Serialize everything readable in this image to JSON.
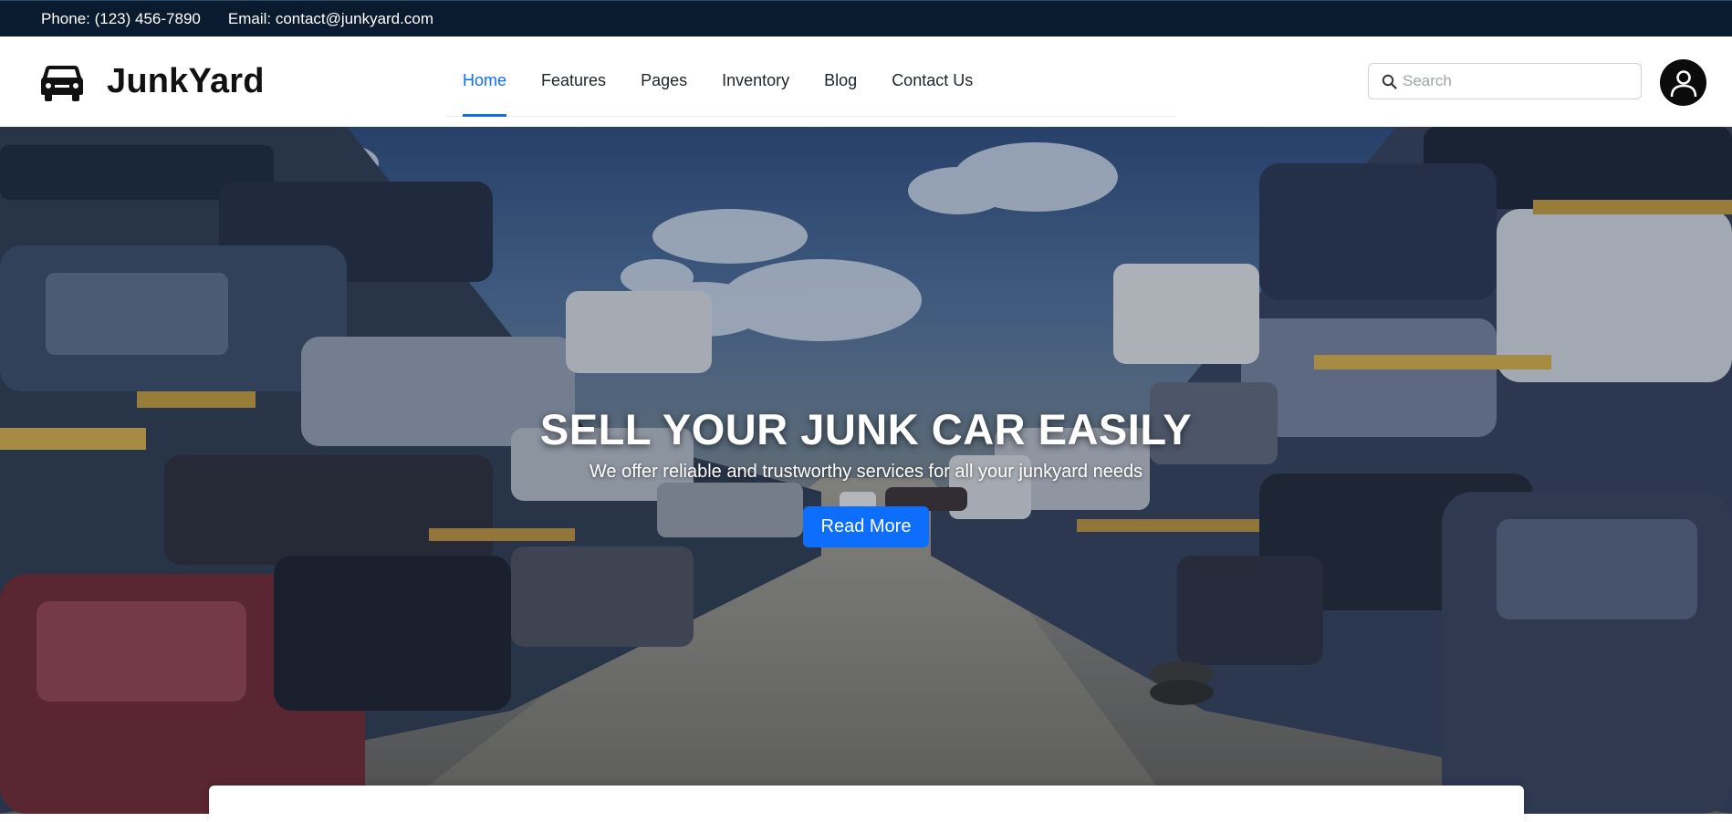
{
  "contact": {
    "phone": "Phone: (123) 456-7890",
    "email": "Email: contact@junkyard.com"
  },
  "brand": {
    "name": "JunkYard",
    "icon": "car-icon"
  },
  "nav": {
    "items": [
      {
        "label": "Home",
        "active": true
      },
      {
        "label": "Features",
        "active": false
      },
      {
        "label": "Pages",
        "active": false
      },
      {
        "label": "Inventory",
        "active": false
      },
      {
        "label": "Blog",
        "active": false
      },
      {
        "label": "Contact Us",
        "active": false
      }
    ],
    "accent_color": "#0d6efd"
  },
  "search": {
    "placeholder": "Search",
    "value": "",
    "icon": "search-icon"
  },
  "account": {
    "icon": "user-icon"
  },
  "hero": {
    "title": "SELL YOUR JUNK CAR EASILY",
    "subtitle": "We offer reliable and trustworthy services for all your junkyard needs",
    "button_label": "Read More",
    "button_color": "#0d6efd"
  },
  "colors": {
    "topbar_bg": "#0a1a2f",
    "text_dark": "#212529"
  }
}
